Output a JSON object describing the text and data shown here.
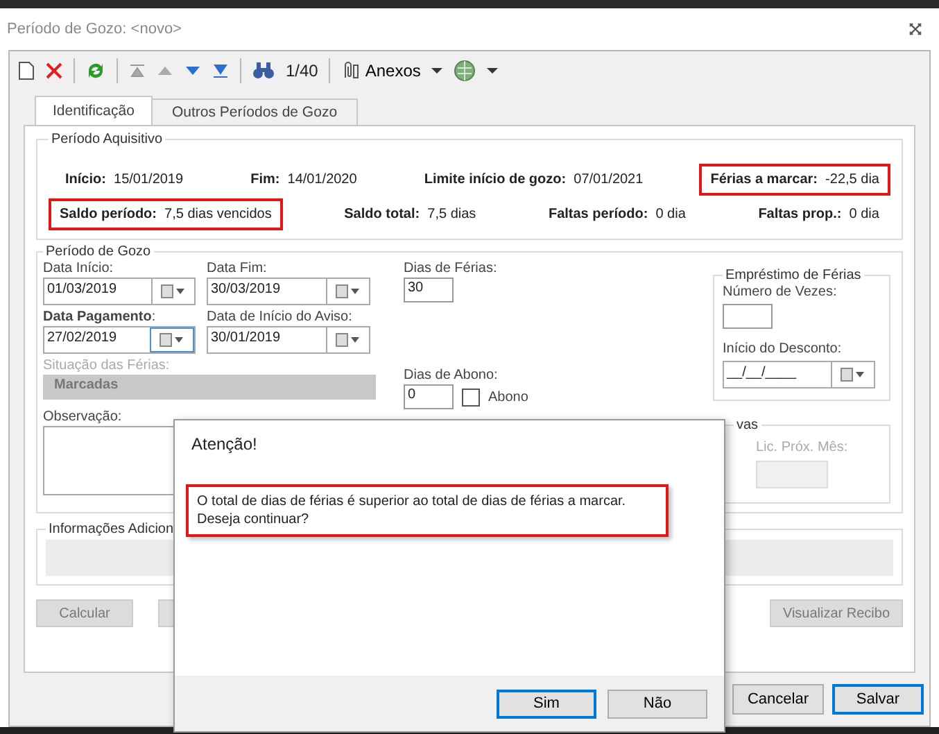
{
  "window": {
    "title": "Período de Gozo: <novo>"
  },
  "toolbar": {
    "record_counter": "1/40",
    "attachments_label": "Anexos"
  },
  "tabs": [
    {
      "label": "Identificação",
      "selected": true
    },
    {
      "label": "Outros Períodos de Gozo",
      "selected": false
    }
  ],
  "periodo_aquisitivo": {
    "title": "Período Aquisitivo",
    "rows": [
      [
        {
          "label": "Início:",
          "value": "15/01/2019",
          "highlighted": false
        },
        {
          "label": "Fim:",
          "value": "14/01/2020",
          "highlighted": false
        },
        {
          "label": "Limite início de gozo:",
          "value": "07/01/2021",
          "highlighted": false
        },
        {
          "label": "Férias a marcar:",
          "value": "-22,5  dia",
          "highlighted": true
        }
      ],
      [
        {
          "label": "Saldo período:",
          "value": "7,5 dias vencidos",
          "highlighted": true
        },
        {
          "label": "Saldo total:",
          "value": "7,5  dias",
          "highlighted": false
        },
        {
          "label": "Faltas período:",
          "value": "0  dia",
          "highlighted": false
        },
        {
          "label": "Faltas prop.:",
          "value": "0  dia",
          "highlighted": false
        }
      ]
    ]
  },
  "periodo_gozo": {
    "title": "Período de Gozo",
    "date_rows": [
      [
        {
          "label": "Data Início:",
          "value": "01/03/2019",
          "focused": false
        },
        {
          "label": "Data Fim:",
          "value": "30/03/2019",
          "focused": false
        }
      ],
      [
        {
          "label": "**Data Pagamento**:",
          "value": "27/02/2019",
          "focused": true
        },
        {
          "label": "Data de Início do Aviso:",
          "value": "30/01/2019",
          "focused": false
        }
      ]
    ],
    "situacao": {
      "label": "Situação das Férias:",
      "value": "Marcadas",
      "disabled": true
    },
    "observacao": {
      "label": "Observação:"
    },
    "dias_ferias": {
      "label": "Dias de Férias:",
      "value": "30"
    },
    "dias_abono": {
      "label": "Dias de Abono:",
      "value": "0"
    },
    "abono_checkbox": {
      "label": "Abono",
      "checked": false
    },
    "emprestimo": {
      "title": "Empréstimo de Férias",
      "count_label": "Número de Vezes:",
      "start_label": "Início do Desconto:",
      "start_value": "__/__/____"
    },
    "group_2": {
      "title": "vas",
      "field_label": "Lic. Próx. Mês:",
      "disabled": true
    }
  },
  "info_group": {
    "title": "Informações Adicion"
  },
  "action_buttons": [
    {
      "label": "Calcular",
      "disabled": true
    },
    {
      "label": "Visualizar Recibo",
      "disabled": true
    }
  ],
  "footer_buttons": [
    {
      "label": "Cancelar",
      "default": false
    },
    {
      "label": "Salvar",
      "default": true
    }
  ],
  "dialog": {
    "title": "Atenção!",
    "message": "O total de dias de férias é superior ao total de dias de férias a marcar.\nDeseja continuar?",
    "highlighted": true,
    "buttons": [
      {
        "label": "Sim",
        "default": true
      },
      {
        "label": "Não",
        "default": false
      }
    ]
  }
}
